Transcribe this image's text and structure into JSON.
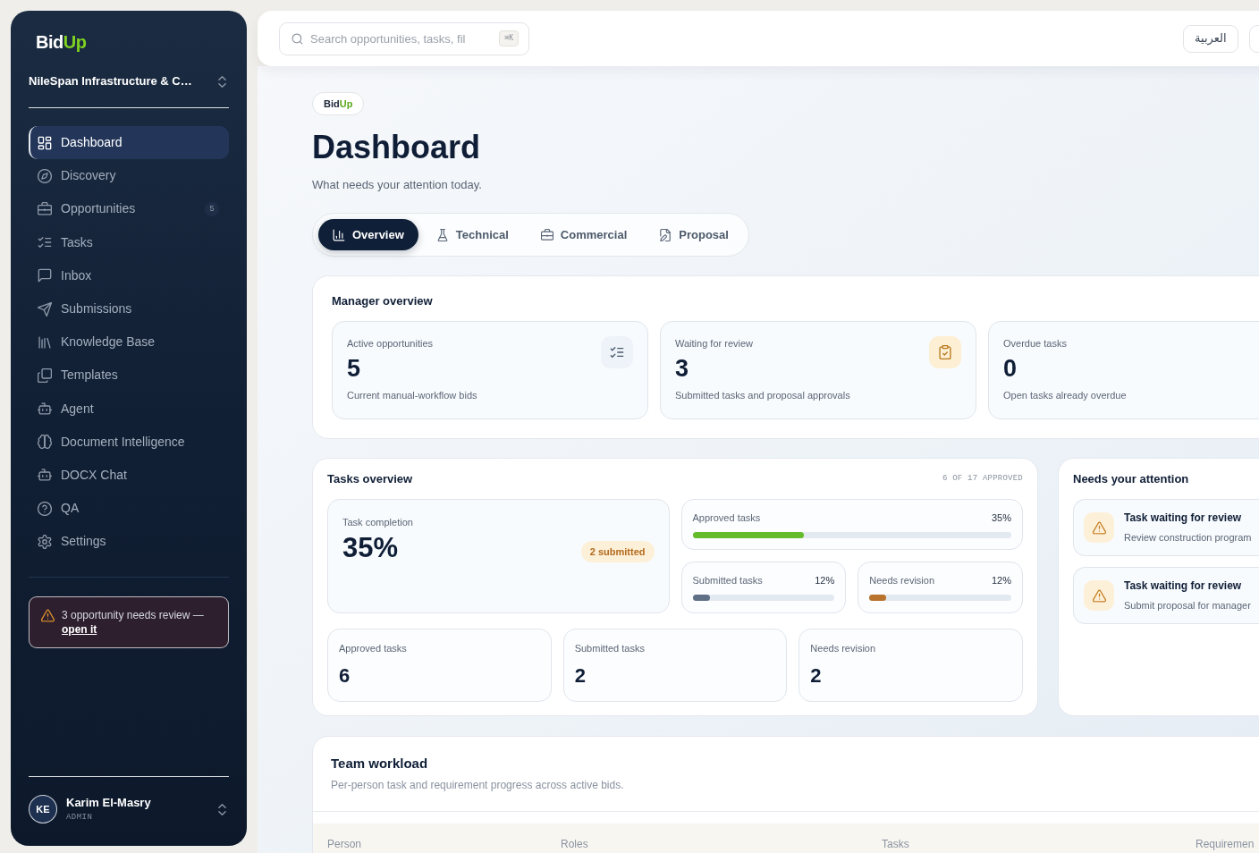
{
  "sidebar": {
    "brand": {
      "prefix": "Bid",
      "accent": "Up"
    },
    "workspace": "NileSpan Infrastructure & C…",
    "nav": [
      {
        "label": "Dashboard",
        "selected": true
      },
      {
        "label": "Discovery",
        "selected": false
      },
      {
        "label": "Opportunities",
        "selected": false,
        "badge": "5"
      },
      {
        "label": "Tasks",
        "selected": false
      },
      {
        "label": "Inbox",
        "selected": false
      },
      {
        "label": "Submissions",
        "selected": false
      },
      {
        "label": "Knowledge Base",
        "selected": false
      },
      {
        "label": "Templates",
        "selected": false
      },
      {
        "label": "Agent",
        "selected": false
      },
      {
        "label": "Document Intelligence",
        "selected": false
      },
      {
        "label": "DOCX Chat",
        "selected": false
      },
      {
        "label": "QA",
        "selected": false
      },
      {
        "label": "Settings",
        "selected": false
      }
    ],
    "alert": {
      "message": "3 opportunity needs review —",
      "link": "open it"
    },
    "user": {
      "initials": "KE",
      "name": "Karim El-Masry",
      "role": "ADMIN"
    }
  },
  "header": {
    "search": {
      "placeholder": "Search opportunities, tasks, fil",
      "shortcut": "⌘K"
    },
    "language": "العربية"
  },
  "page": {
    "badge": {
      "prefix": "Bid",
      "accent": "Up"
    },
    "title": "Dashboard",
    "subtitle": "What needs your attention today.",
    "tabs": [
      {
        "label": "Overview",
        "selected": true
      },
      {
        "label": "Technical",
        "selected": false
      },
      {
        "label": "Commercial",
        "selected": false
      },
      {
        "label": "Proposal",
        "selected": false
      }
    ]
  },
  "manager_overview": {
    "title": "Manager overview",
    "cards": [
      {
        "label": "Active opportunities",
        "value": "5",
        "description": "Current manual-workflow bids",
        "kind": "neutral"
      },
      {
        "label": "Waiting for review",
        "value": "3",
        "description": "Submitted tasks and proposal approvals",
        "kind": "warning"
      },
      {
        "label": "Overdue tasks",
        "value": "0",
        "description": "Open tasks already overdue"
      }
    ]
  },
  "tasks_overview": {
    "title": "Tasks overview",
    "summary": "6 OF 17 APPROVED",
    "completion": {
      "label": "Task completion",
      "value": "35%",
      "badge": "2 submitted"
    },
    "bars": [
      {
        "label": "Approved tasks",
        "reading": "35%",
        "level": 0.35,
        "color": "#65bc2b"
      },
      {
        "label": "Submitted tasks",
        "reading": "12%",
        "level": 0.12,
        "color": "#5f6f86"
      },
      {
        "label": "Needs revision",
        "reading": "12%",
        "level": 0.12,
        "color": "#b8732e"
      }
    ],
    "counts": [
      {
        "label": "Approved tasks",
        "value": "6"
      },
      {
        "label": "Submitted tasks",
        "value": "2"
      },
      {
        "label": "Needs revision",
        "value": "2"
      }
    ]
  },
  "attention": {
    "title": "Needs your attention",
    "items": [
      {
        "title": "Task waiting for review",
        "description": "Review construction program"
      },
      {
        "title": "Task waiting for review",
        "description": "Submit proposal for manager"
      }
    ]
  },
  "team_workload": {
    "title": "Team workload",
    "description": "Per-person task and requirement progress across active bids.",
    "columns": [
      "Person",
      "Roles",
      "Tasks",
      "Requiremen"
    ]
  }
}
